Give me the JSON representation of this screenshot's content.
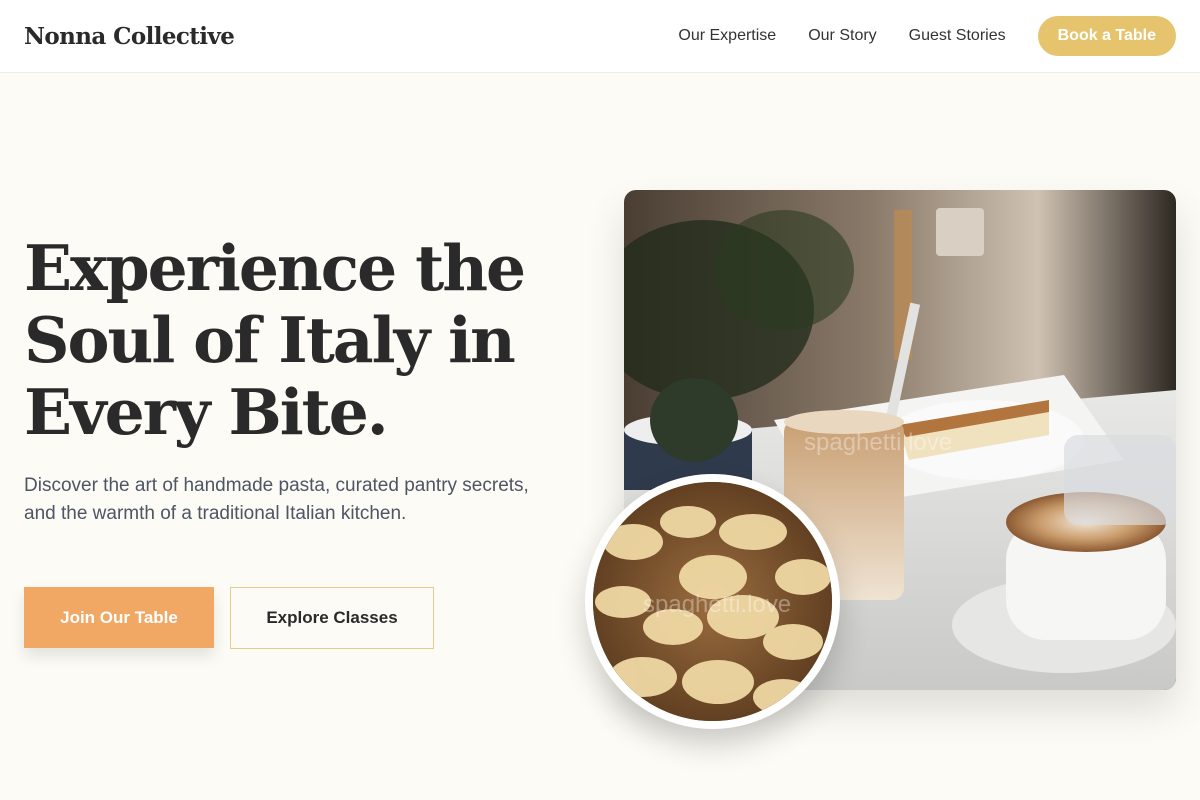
{
  "header": {
    "brand": "Nonna Collective",
    "nav": [
      "Our Expertise",
      "Our Story",
      "Guest Stories"
    ],
    "cta": "Book a Table"
  },
  "hero": {
    "title_lines": [
      "Experience the",
      "Soul of Italy in",
      "Every Bite."
    ],
    "subtitle": "Discover the art of handmade pasta, curated pantry secrets, and the warmth of a traditional Italian kitchen.",
    "primary_button": "Join Our Table",
    "secondary_button": "Explore Classes"
  },
  "images": {
    "main_watermark": "spaghetti.love",
    "round_watermark": "spaghetti.love"
  },
  "colors": {
    "accent_gold": "#e6c46e",
    "primary_orange": "#f0a864",
    "background": "#fcfbf5"
  }
}
